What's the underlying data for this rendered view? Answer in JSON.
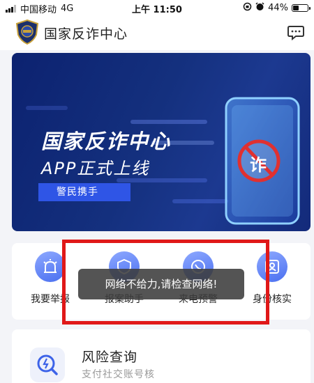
{
  "status_bar": {
    "carrier": "中国移动",
    "network": "4G",
    "time": "上午 11:50",
    "battery_text": "44%",
    "battery_level": 0.44
  },
  "header": {
    "title": "国家反诈中心",
    "logo_icon": "police-badge-icon",
    "message_icon": "message-icon"
  },
  "banner": {
    "title_line1": "国家反诈中心",
    "title_line2": "APP正式上线",
    "tag": "警民携手",
    "phone_badge": "诈",
    "colors": {
      "bg": "#14307e",
      "tag": "#2f55e6",
      "prohibit": "#e03030"
    }
  },
  "quick_actions": [
    {
      "label": "我要举报",
      "icon": "alarm-icon"
    },
    {
      "label": "报案助手",
      "icon": "shield-icon"
    },
    {
      "label": "来电预警",
      "icon": "phone-alert-icon"
    },
    {
      "label": "身份核实",
      "icon": "id-card-icon"
    }
  ],
  "risk_query": {
    "title": "风险查询",
    "subtitle": "支付社交账号核",
    "icon": "search-icon"
  },
  "toast": {
    "text": "网络不给力,请检查网络!"
  },
  "annotation": {
    "color": "#e01818"
  }
}
